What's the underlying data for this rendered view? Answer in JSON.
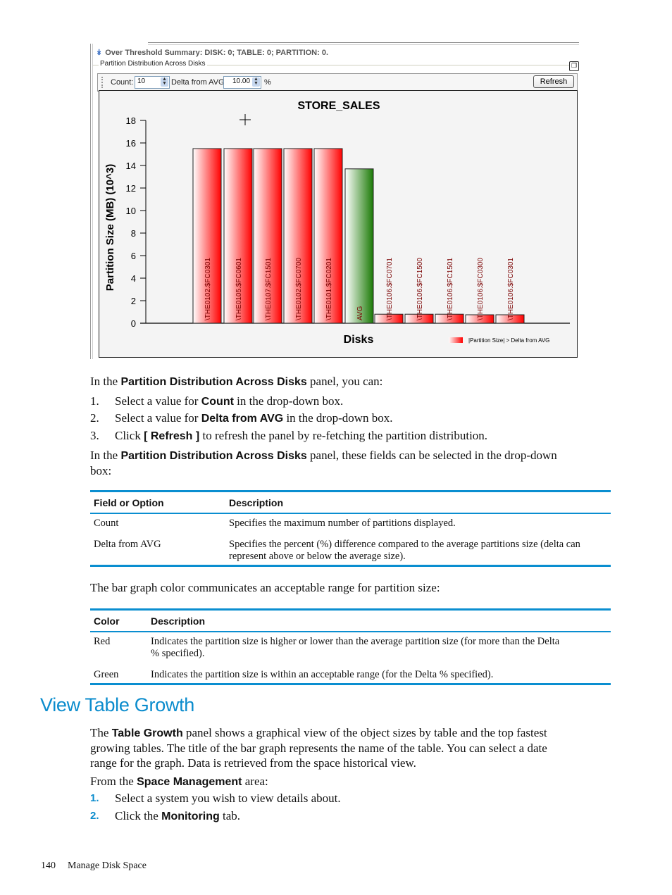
{
  "screenshot": {
    "summary": "Over Threshold Summary: DISK: 0; TABLE: 0; PARTITION: 0.",
    "group_title": "Partition Distribution Across Disks",
    "toolbar": {
      "count_label": "Count:",
      "count_value": "10",
      "delta_label": "Delta from AVG:",
      "delta_value": "10.00",
      "percent_label": "%",
      "refresh_label": "Refresh"
    },
    "colors": {
      "red": "#ff0000",
      "green": "#1e7a0a",
      "accent": "#0b8ccd"
    }
  },
  "chart_data": {
    "type": "bar",
    "title": "STORE_SALES",
    "xlabel": "Disks",
    "ylabel": "Partition Size (MB) (10^3)",
    "ylim": [
      0,
      18
    ],
    "yticks": [
      "0",
      "2",
      "4",
      "6",
      "8",
      "10",
      "12",
      "14",
      "16",
      "18"
    ],
    "categories": [
      "\\THE0102.$FC0301",
      "\\THE0105.$FC0601",
      "\\THE0107.$FC1501",
      "\\THE0102.$FC0700",
      "\\THE0101.$FC0201",
      "AVG",
      "\\THE0106.$FC0701",
      "\\THE0106.$FC1500",
      "\\THE0106.$FC1501",
      "\\THE0106.$FC0300",
      "\\THE0106.$FC0301"
    ],
    "values": [
      15.5,
      15.5,
      15.5,
      15.5,
      15.5,
      13.7,
      0.8,
      0.8,
      0.8,
      0.75,
      0.75
    ],
    "bar_colors": [
      "red",
      "red",
      "red",
      "red",
      "red",
      "green",
      "red",
      "red",
      "red",
      "red",
      "red"
    ],
    "legend": [
      {
        "label": "|Partition Size| > Delta from AVG",
        "color": "red"
      }
    ],
    "legend_position": "bottom-right",
    "grid": false
  },
  "doc": {
    "intro": {
      "pre": "In the ",
      "bold": "Partition Distribution Across Disks",
      "post": " panel, you can:"
    },
    "steps": [
      {
        "num": "1.",
        "pre": "Select a value for ",
        "bold": "Count",
        "post": " in the drop-down box."
      },
      {
        "num": "2.",
        "pre": "Select a value for ",
        "bold": "Delta from AVG",
        "post": " in the drop-down box."
      },
      {
        "num": "3.",
        "pre": "Click ",
        "bold": "[ Refresh ]",
        "post": " to refresh the panel by re-fetching the partition distribution."
      }
    ],
    "intro2": {
      "pre": "In the ",
      "bold": "Partition Distribution Across Disks",
      "post": " panel, these fields can be selected in the drop-down",
      "line2": "box:"
    },
    "table1": {
      "headers": [
        "Field or Option",
        "Description"
      ],
      "rows": [
        [
          "Count",
          "Specifies the maximum number of partitions displayed.",
          ""
        ],
        [
          "Delta from AVG",
          "Specifies the percent (%) difference compared to the average partitions size (delta can",
          "represent above or below the average size)."
        ]
      ]
    },
    "bar_color_text": "The bar graph color communicates an acceptable range for partition size:",
    "table2": {
      "headers": [
        "Color",
        "Description"
      ],
      "rows": [
        [
          "Red",
          "Indicates the partition size is higher or lower than the average partition size (for more than the Delta",
          "% specified)."
        ],
        [
          "Green",
          "Indicates the partition size is within an acceptable range (for the Delta % specified).",
          ""
        ]
      ]
    },
    "section_title": "View Table Growth",
    "growth_para": {
      "pre": "The ",
      "bold": "Table Growth",
      "l1": " panel shows a graphical view of the object sizes by table and the top fastest",
      "l2": "growing tables. The title of the bar graph represents the name of the table. You can select a date",
      "l3": "range for the graph. Data is retrieved from the space historical view."
    },
    "from_area": {
      "pre": "From the ",
      "bold": "Space Management",
      "post": " area:"
    },
    "steps2": [
      {
        "num": "1.",
        "pre": "Select a system you wish to view details about.",
        "bold": "",
        "post": ""
      },
      {
        "num": "2.",
        "pre": "Click the ",
        "bold": "Monitoring",
        "post": " tab."
      }
    ],
    "footer": {
      "page": "140",
      "title": "Manage Disk Space"
    }
  }
}
